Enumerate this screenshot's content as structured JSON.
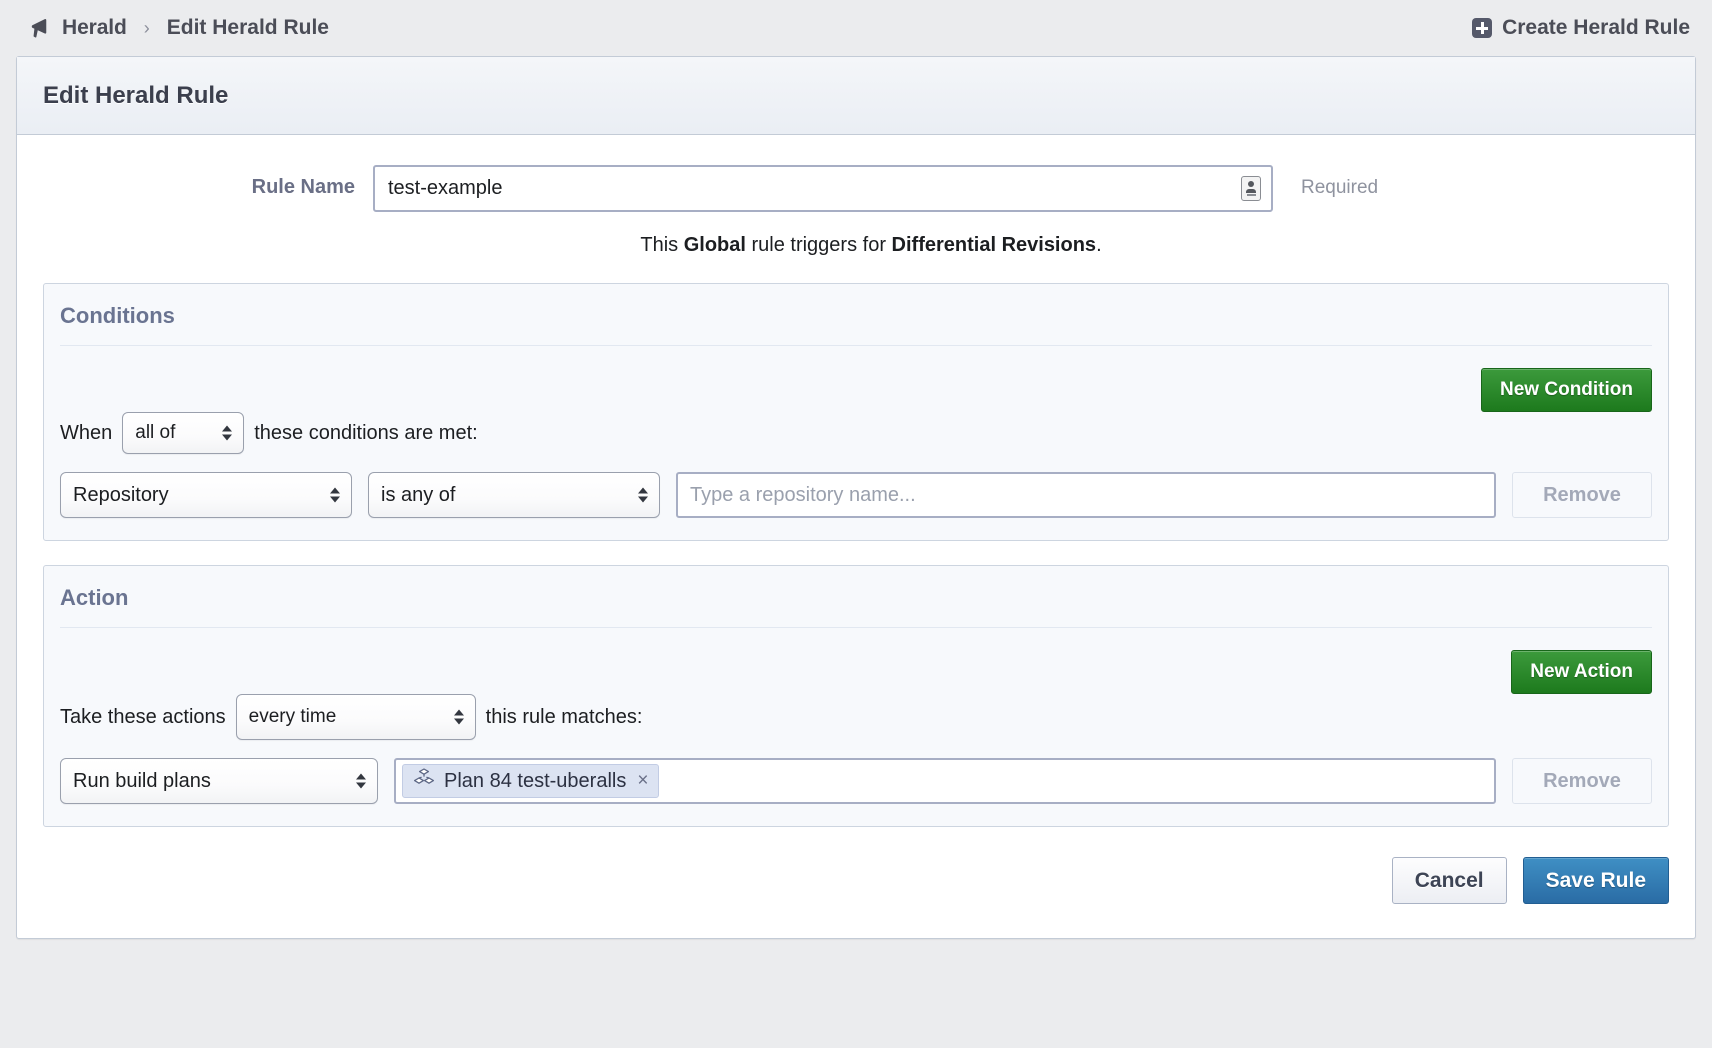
{
  "crumbs": {
    "app_icon": "megaphone-icon",
    "app_label": "Herald",
    "separator": "›",
    "current_label": "Edit Herald Rule",
    "action_icon": "plus-square-icon",
    "action_label": "Create Herald Rule"
  },
  "panel": {
    "title": "Edit Herald Rule"
  },
  "form": {
    "rule_name_label": "Rule Name",
    "rule_name_value": "test-example",
    "rule_name_placeholder": "",
    "autofill_icon": "contact-card-icon",
    "required_note": "Required",
    "trigger_prefix": "This ",
    "trigger_scope": "Global",
    "trigger_middle": " rule triggers for ",
    "trigger_object": "Differential Revisions",
    "trigger_suffix": "."
  },
  "conditions": {
    "heading": "Conditions",
    "new_button": "New Condition",
    "when_prefix": "When",
    "match_mode": "all of",
    "when_suffix": "these conditions are met:",
    "rows": [
      {
        "field": "Repository",
        "operator": "is any of",
        "value": "",
        "value_placeholder": "Type a repository name...",
        "remove_label": "Remove"
      }
    ]
  },
  "action": {
    "heading": "Action",
    "new_button": "New Action",
    "take_prefix": "Take these actions",
    "repetition": "every time",
    "take_suffix": "this rule matches:",
    "rows": [
      {
        "type": "Run build plans",
        "token_icon": "build-plan-icon",
        "token_label": "Plan 84 test-uberalls",
        "token_remove": "×",
        "remove_label": "Remove"
      }
    ]
  },
  "footer": {
    "cancel_label": "Cancel",
    "save_label": "Save Rule"
  },
  "colors": {
    "accent_green": "#1d7a1d",
    "accent_blue": "#2a6ca5",
    "page_bg": "#ebecee",
    "section_bg": "#f7f9fc"
  }
}
